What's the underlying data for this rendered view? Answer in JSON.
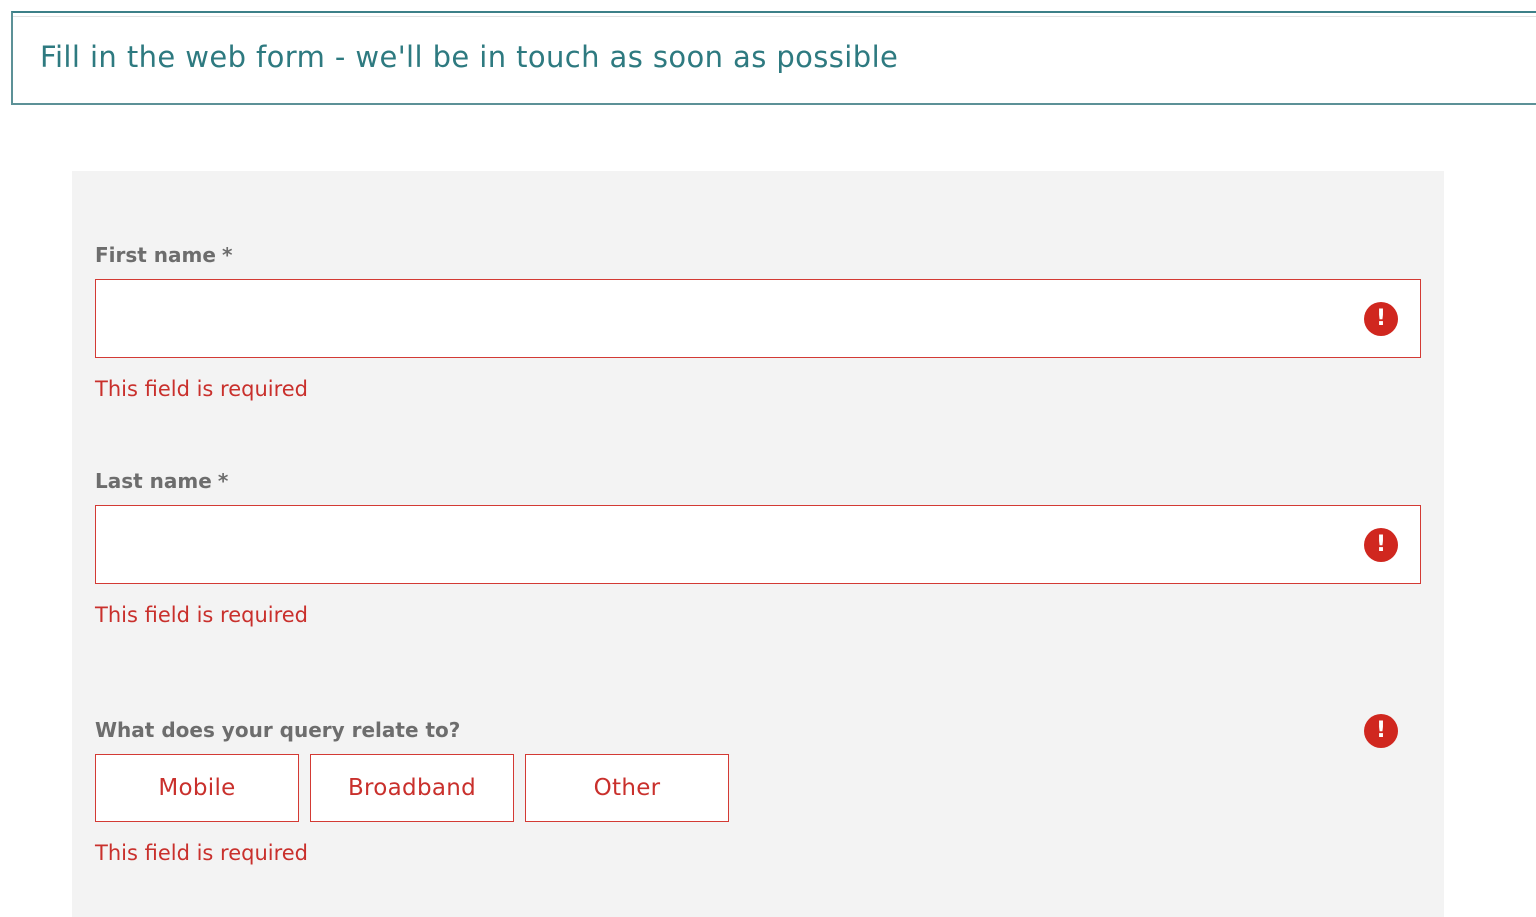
{
  "header": {
    "text": "Fill in the web form - we'll be in touch as soon as possible"
  },
  "form": {
    "first_name": {
      "label": "First name",
      "required_marker": "*",
      "value": "",
      "error_icon": "!",
      "error": "This field is required"
    },
    "last_name": {
      "label": "Last name",
      "required_marker": "*",
      "value": "",
      "error_icon": "!",
      "error": "This field is required"
    },
    "query": {
      "label": "What does your query relate to?",
      "error_icon": "!",
      "options": [
        "Mobile",
        "Broadband",
        "Other"
      ],
      "error": "This field is required"
    }
  },
  "icons": {
    "error": "exclamation-circle-icon"
  },
  "colors": {
    "brand_teal": "#2e7a80",
    "error_red": "#d0271f",
    "panel_bg": "#f3f3f3",
    "label_gray": "#6d6d6d"
  }
}
